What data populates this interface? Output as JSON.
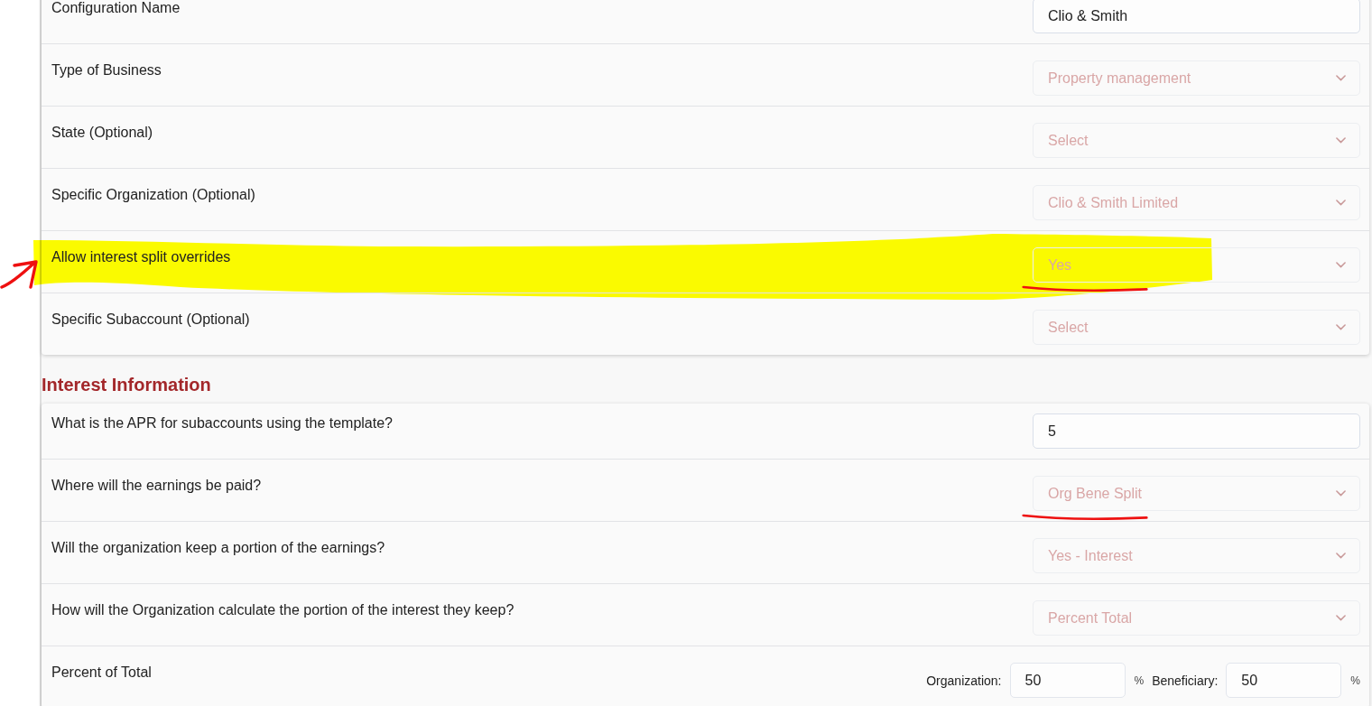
{
  "configuration": {
    "rows": [
      {
        "label": "Configuration Name",
        "kind": "input",
        "value": "Clio & Smith",
        "disabled": false,
        "highlighted": false,
        "arrow": false,
        "underlined": false
      },
      {
        "label": "Type of Business",
        "kind": "select",
        "value": "Property management",
        "disabled": true,
        "highlighted": false,
        "arrow": false,
        "underlined": false
      },
      {
        "label": "State (Optional)",
        "kind": "select",
        "value": "Select",
        "disabled": true,
        "highlighted": false,
        "arrow": false,
        "underlined": false
      },
      {
        "label": "Specific Organization (Optional)",
        "kind": "select",
        "value": "Clio & Smith Limited",
        "disabled": true,
        "highlighted": false,
        "arrow": false,
        "underlined": false
      },
      {
        "label": "Allow interest split overrides",
        "kind": "select",
        "value": "Yes",
        "disabled": true,
        "highlighted": true,
        "arrow": true,
        "underlined": true
      },
      {
        "label": "Specific Subaccount (Optional)",
        "kind": "select",
        "value": "Select",
        "disabled": true,
        "highlighted": false,
        "arrow": false,
        "underlined": false
      }
    ]
  },
  "interest_information": {
    "title": "Interest Information",
    "rows": [
      {
        "label": "What is the APR for subaccounts using the template?",
        "kind": "input",
        "value": "5",
        "disabled": false,
        "highlighted": false,
        "arrow": false,
        "underlined": false
      },
      {
        "label": "Where will the earnings be paid?",
        "kind": "select",
        "value": "Org Bene Split",
        "disabled": true,
        "highlighted": false,
        "arrow": false,
        "underlined": true
      },
      {
        "label": "Will the organization keep a portion of the earnings?",
        "kind": "select",
        "value": "Yes - Interest",
        "disabled": true,
        "highlighted": false,
        "arrow": false,
        "underlined": false
      },
      {
        "label": "How will the Organization calculate the portion of the interest they keep?",
        "kind": "select",
        "value": "Percent Total",
        "disabled": true,
        "highlighted": false,
        "arrow": false,
        "underlined": false
      },
      {
        "label": "Percent of Total",
        "kind": "split",
        "fields": [
          {
            "label": "Organization:",
            "value": "50",
            "unit": "%",
            "disabled": false
          },
          {
            "label": "Beneficiary:",
            "value": "50",
            "unit": "%",
            "disabled": false
          }
        ],
        "highlighted": false,
        "arrow": false,
        "underlined": false
      }
    ]
  }
}
